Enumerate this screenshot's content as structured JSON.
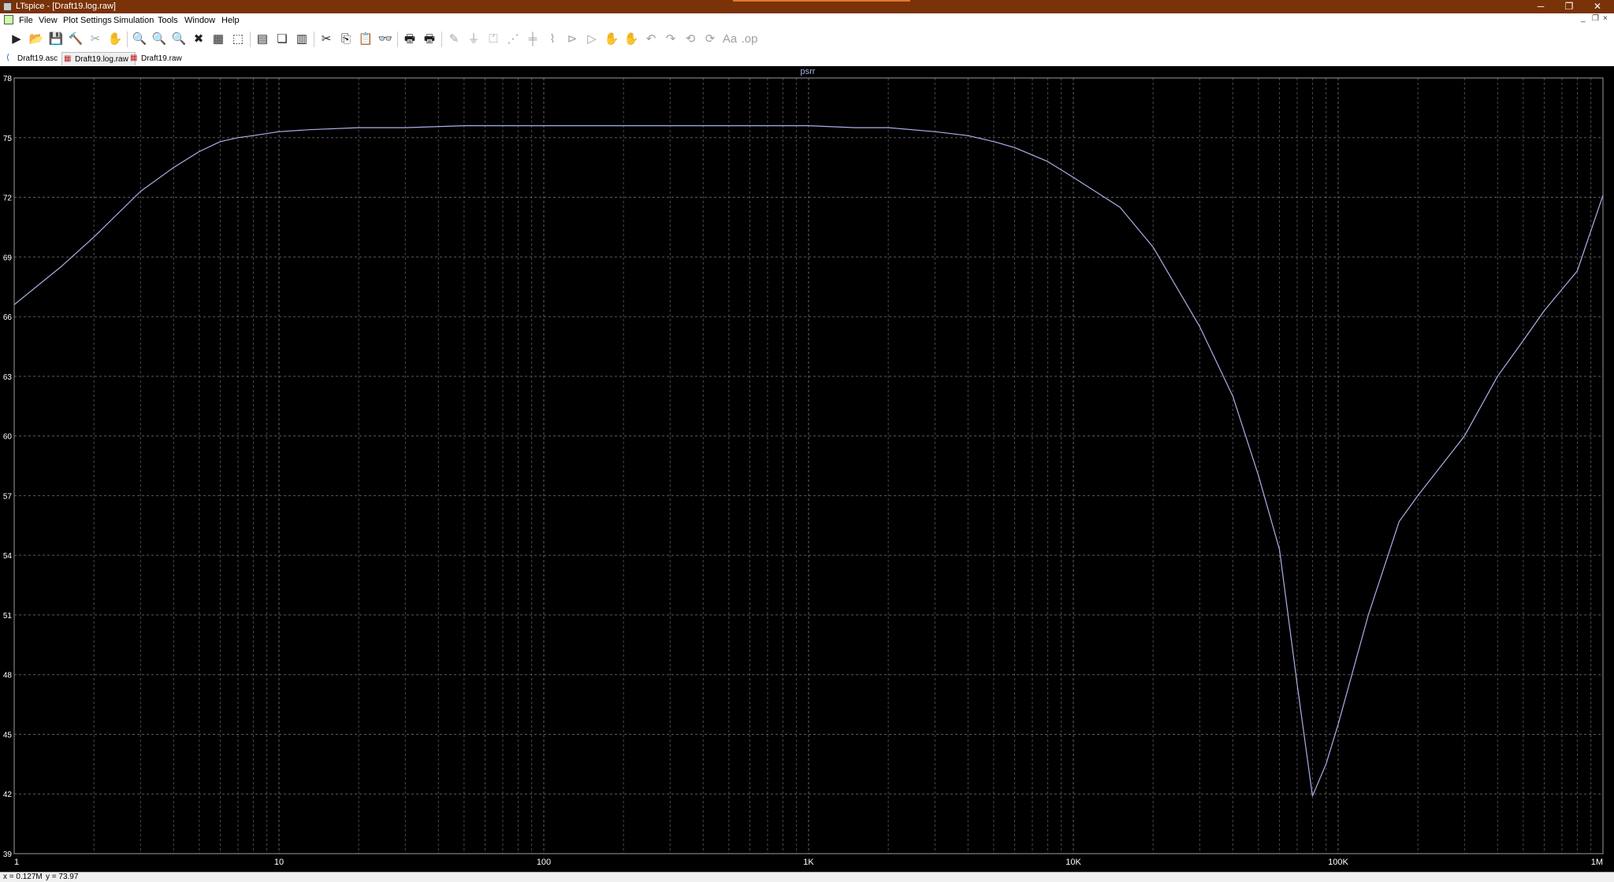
{
  "window": {
    "title": "LTspice - [Draft19.log.raw]",
    "min_glyph": "─",
    "restore_glyph": "❐",
    "close_glyph": "✕"
  },
  "menu": [
    "File",
    "View",
    "Plot Settings",
    "Simulation",
    "Tools",
    "Window",
    "Help"
  ],
  "mdi": {
    "min_glyph": "_",
    "restore_glyph": "❐",
    "close_glyph": "×"
  },
  "toolbar": {
    "icons": [
      "run-icon",
      "open-icon",
      "save-icon",
      "control-panel-icon",
      "halt-icon",
      "pan-hand-icon",
      "zoom-in-icon",
      "zoom-full-icon",
      "zoom-out-icon",
      "zoom-cancel-icon",
      "autorange-icon",
      "zoom-box-icon",
      "tile-horizontal-icon",
      "cascade-icon",
      "tile-vertical-icon",
      "cut-icon",
      "copy-icon",
      "paste-icon",
      "find-icon",
      "print-icon",
      "print-preview-icon",
      "wire-icon",
      "ground-icon",
      "label-icon",
      "resistor-icon",
      "capacitor-icon",
      "inductor-icon",
      "diode-icon",
      "component-icon",
      "move-icon",
      "drag-icon",
      "undo-icon",
      "redo-icon",
      "rotate-icon",
      "mirror-icon",
      "text-icon",
      "spice-directive-icon"
    ],
    "glyphs": [
      "▶",
      "📂",
      "💾",
      "🔨",
      "✂",
      "✋",
      "🔍",
      "🔍",
      "🔍",
      "✖",
      "▦",
      "⬚",
      "▤",
      "❏",
      "▥",
      "✂",
      "⎘",
      "📋",
      "👓",
      "🖶",
      "🖶",
      "✎",
      "⏚",
      "⏍",
      "⋰",
      "╪",
      "⌇",
      "⊳",
      "▷",
      "✋",
      "✋",
      "↶",
      "↷",
      "⟲",
      "⟳",
      "Aa",
      ".op"
    ]
  },
  "tabs": [
    {
      "label": "Draft19.asc",
      "icon": "schematic-icon",
      "glyph": "⟨",
      "active": false
    },
    {
      "label": "Draft19.log.raw",
      "icon": "waveform-icon",
      "glyph": "▦",
      "active": true
    },
    {
      "label": "Draft19.raw",
      "icon": "waveform-icon",
      "glyph": "▦",
      "active": false
    }
  ],
  "colors": {
    "background": "#000000",
    "trace": "#aab1e6",
    "grid": "#6c6c6c",
    "axis_text": "#ffffff"
  },
  "chart_data": {
    "type": "line",
    "title": "psrr",
    "xlabel": "",
    "ylabel": "",
    "xscale": "log",
    "xlim": [
      1,
      1000000
    ],
    "ylim": [
      39,
      78
    ],
    "grid": true,
    "yticks": [
      39,
      42,
      45,
      48,
      51,
      54,
      57,
      60,
      63,
      66,
      69,
      72,
      75,
      78
    ],
    "ytick_labels": [
      "39",
      "42",
      "45",
      "48",
      "51",
      "54",
      "57",
      "60",
      "63",
      "66",
      "69",
      "72",
      "75",
      "78"
    ],
    "xticks": [
      1,
      10,
      100,
      1000,
      10000,
      100000,
      1000000
    ],
    "xtick_labels": [
      "1",
      "10",
      "100",
      "1K",
      "10K",
      "100K",
      "1M"
    ],
    "series": [
      {
        "x": [
          1,
          1.5,
          2,
          3,
          4,
          5,
          6,
          7,
          8,
          10,
          13,
          20,
          30,
          50,
          100,
          200,
          500,
          1000,
          1500,
          2000,
          3000,
          4000,
          5000,
          6000,
          8000,
          10000,
          15000,
          20000,
          30000,
          40000,
          50000,
          60000,
          70000,
          80000,
          90000,
          100000,
          130000,
          170000,
          200000,
          300000,
          400000,
          500000,
          600000,
          800000,
          1000000
        ],
        "y": [
          66.6,
          68.5,
          70.0,
          72.3,
          73.5,
          74.3,
          74.8,
          75.0,
          75.1,
          75.3,
          75.4,
          75.5,
          75.5,
          75.6,
          75.6,
          75.6,
          75.6,
          75.6,
          75.5,
          75.5,
          75.3,
          75.1,
          74.8,
          74.5,
          73.8,
          73.0,
          71.5,
          69.5,
          65.5,
          62.0,
          58.0,
          54.3,
          47.5,
          41.9,
          43.5,
          45.5,
          51.0,
          55.7,
          57.0,
          60.0,
          63.0,
          64.8,
          66.3,
          68.3,
          72.1
        ]
      }
    ]
  },
  "status": {
    "x_readout": "x = 0.127M",
    "y_readout": "y = 73.97"
  }
}
